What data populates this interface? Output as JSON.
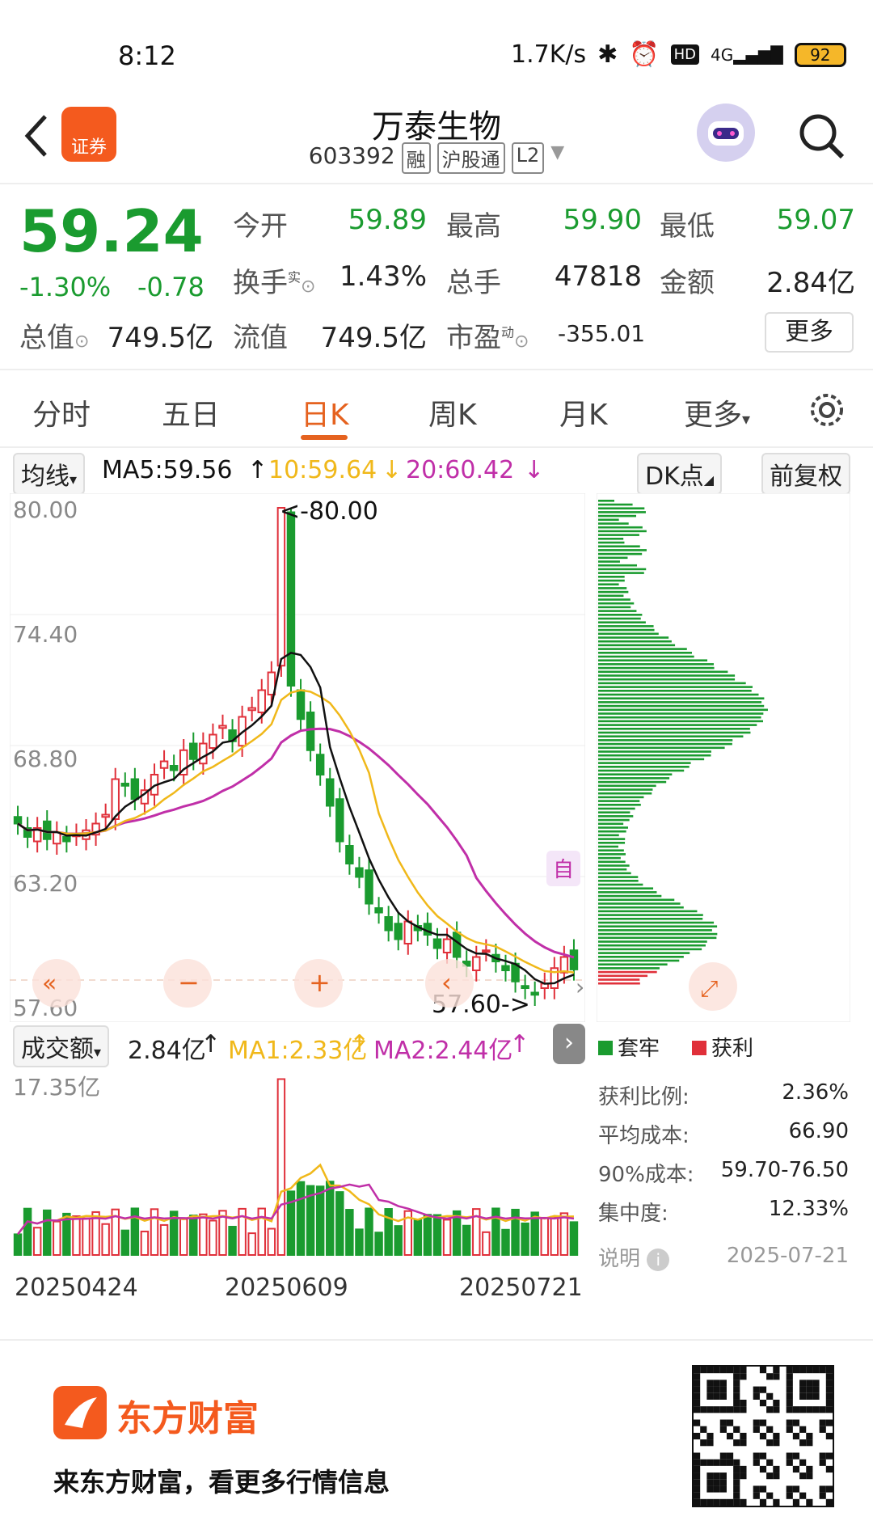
{
  "status_bar": {
    "time": "8:12",
    "net_speed": "1.7K/s",
    "network": "4G",
    "hd": "HD",
    "battery": "92"
  },
  "header": {
    "logo_text": "证券",
    "title": "万泰生物",
    "code": "603392",
    "tags": [
      "融",
      "沪股通",
      "L2"
    ]
  },
  "quote": {
    "price": "59.24",
    "change_pct": "-1.30%",
    "change_abs": "-0.78",
    "open_label": "今开",
    "open": "59.89",
    "high_label": "最高",
    "high": "59.90",
    "low_label": "最低",
    "low": "59.07",
    "turnover_label": "换手",
    "turnover_sup": "实",
    "turnover": "1.43%",
    "volume_label": "总手",
    "volume": "47818",
    "amount_label": "金额",
    "amount": "2.84亿",
    "mktcap_label": "总值",
    "mktcap": "749.5亿",
    "float_label": "流值",
    "float_cap": "749.5亿",
    "pe_label": "市盈",
    "pe_sup": "动",
    "pe": "-355.01",
    "more_label": "更多"
  },
  "tabs": [
    "分时",
    "五日",
    "日K",
    "周K",
    "月K",
    "更多"
  ],
  "active_tab": "日K",
  "ma_bar": {
    "select": "均线",
    "ma5": "MA5:59.56",
    "ma10": "10:59.64",
    "ma20": "20:60.42",
    "dk": "DK点",
    "fq": "前复权"
  },
  "kline": {
    "y_labels": [
      "80.00",
      "74.40",
      "68.80",
      "63.20",
      "57.60"
    ],
    "max_label": "<-80.00",
    "min_label": "57.60->",
    "auto_label": "自"
  },
  "volume_bar": {
    "select": "成交额",
    "value": "2.84亿",
    "ma1": "MA1:2.33亿",
    "ma2": "MA2:2.44亿",
    "y_label": "17.35亿",
    "dates": [
      "20250424",
      "20250609",
      "20250721"
    ]
  },
  "chip_panel": {
    "legend_trapped": "套牢",
    "legend_profit": "获利",
    "profit_ratio_label": "获利比例:",
    "profit_ratio": "2.36%",
    "avg_cost_label": "平均成本:",
    "avg_cost": "66.90",
    "cost90_label": "90%成本:",
    "cost90": "59.70-76.50",
    "concentration_label": "集中度:",
    "concentration": "12.33%",
    "note_label": "说明",
    "date": "2025-07-21"
  },
  "footer": {
    "brand": "东方财富",
    "slogan": "来东方财富，看更多行情信息"
  },
  "colors": {
    "up": "#e0303a",
    "down": "#1a9b2f",
    "ma5": "#111111",
    "ma10": "#f0b81a",
    "ma20": "#c02fa8",
    "accent": "#e5621f"
  },
  "chart_data": {
    "type": "candlestick",
    "ylim": [
      57.6,
      80.0
    ],
    "closes": [
      65.8,
      65.2,
      65.6,
      65.1,
      65.4,
      65.0,
      65.3,
      65.5,
      65.8,
      66.2,
      67.8,
      67.5,
      66.9,
      67.3,
      68.0,
      68.6,
      68.2,
      69.1,
      68.7,
      69.4,
      69.8,
      70.2,
      69.5,
      70.6,
      71.0,
      71.8,
      72.6,
      80.0,
      72.0,
      70.5,
      69.1,
      68.0,
      66.6,
      65.0,
      64.0,
      63.4,
      62.2,
      61.8,
      61.0,
      60.6,
      61.4,
      61.0,
      60.8,
      60.2,
      60.6,
      59.8,
      59.4,
      59.8,
      60.1,
      59.6,
      59.2,
      58.7,
      58.4,
      58.1,
      58.6,
      59.3,
      59.8,
      59.24
    ],
    "ma5_end": 59.56,
    "ma10_end": 59.64,
    "ma20_end": 60.42
  }
}
